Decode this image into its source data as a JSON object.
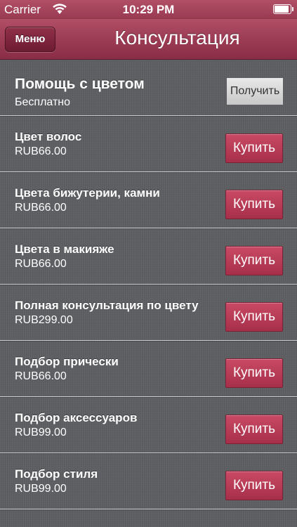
{
  "status_bar": {
    "carrier": "Carrier",
    "time": "10:29 PM"
  },
  "nav": {
    "menu_label": "Меню",
    "title": "Консультация"
  },
  "items": [
    {
      "name": "Помощь с цветом",
      "price": "Бесплатно",
      "button": "Получить"
    },
    {
      "name": "Цвет волос",
      "price": "RUB66.00",
      "button": "Купить"
    },
    {
      "name": "Цвета бижутерии, камни",
      "price": "RUB66.00",
      "button": "Купить"
    },
    {
      "name": "Цвета в макияже",
      "price": "RUB66.00",
      "button": "Купить"
    },
    {
      "name": "Полная консультация по цвету",
      "price": "RUB299.00",
      "button": "Купить"
    },
    {
      "name": "Подбор прически",
      "price": "RUB66.00",
      "button": "Купить"
    },
    {
      "name": "Подбор аксессуаров",
      "price": "RUB99.00",
      "button": "Купить"
    },
    {
      "name": "Подбор стиля",
      "price": "RUB99.00",
      "button": "Купить"
    }
  ],
  "colors": {
    "accent": "#9e3e56",
    "buy_button": "#b83a56",
    "background": "#5c5e62"
  }
}
